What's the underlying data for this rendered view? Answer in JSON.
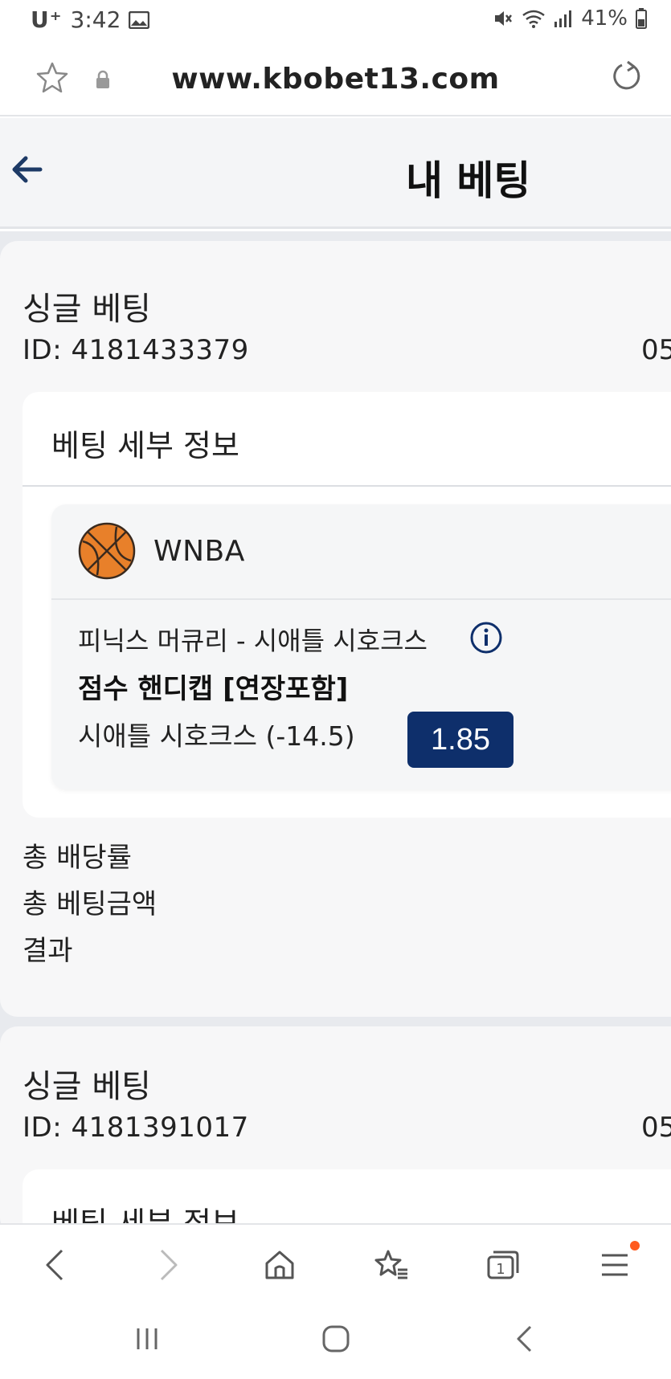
{
  "status_bar": {
    "carrier": "U⁺",
    "time": "3:42",
    "battery": "41%",
    "icons": [
      "image-icon",
      "mute-icon",
      "wifi-icon",
      "signal-icon",
      "battery-icon"
    ]
  },
  "browser": {
    "url": "www.kbobet13.com",
    "icons": [
      "bookmark-star-icon",
      "lock-icon",
      "reload-icon"
    ]
  },
  "header": {
    "title": "내 베팅",
    "back_icon": "back-arrow-icon"
  },
  "bets": [
    {
      "type": "싱글 베팅",
      "id": "ID: 4181433379",
      "date": "05",
      "details_title": "베팅 세부 정보",
      "league": "WNBA",
      "league_icon": "basketball-icon",
      "match": "피닉스 머큐리 - 시애틀 시호크스",
      "market": "점수 핸디캡 [연장포함]",
      "selection": "시애틀 시호크스 (-14.5)",
      "odds": "1.85",
      "summary": [
        "총 배당률",
        "총 베팅금액",
        "결과"
      ]
    },
    {
      "type": "싱글 베팅",
      "id": "ID: 4181391017",
      "date": "05",
      "details_title": "베팅 세부 정보"
    }
  ],
  "colors": {
    "accent": "#0e2f6b",
    "page_bg": "#e8eaee",
    "card_bg": "#f7f7f8",
    "notification_dot": "#ff5a1f"
  },
  "browser_nav": [
    "back-icon",
    "forward-icon",
    "home-icon",
    "bookmarks-icon",
    "tabs-icon",
    "menu-icon"
  ],
  "tabs_count": "1",
  "system_nav": [
    "recent-apps-icon",
    "home-button-icon",
    "system-back-icon"
  ]
}
